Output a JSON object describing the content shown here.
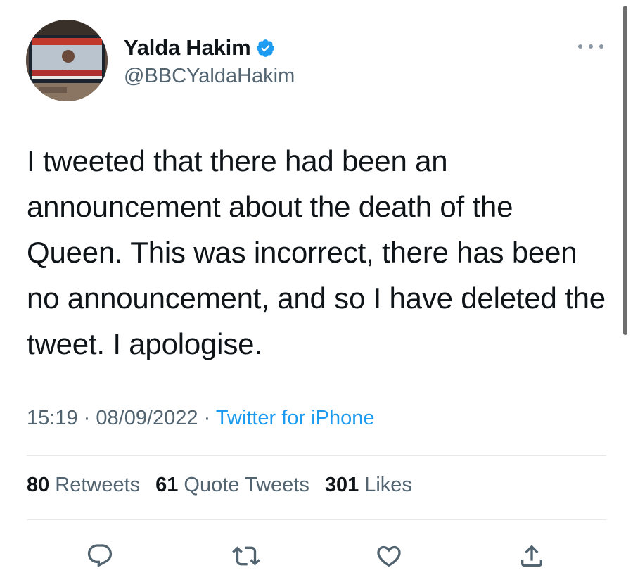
{
  "author": {
    "display_name": "Yalda Hakim",
    "handle": "@BBCYaldaHakim",
    "verified": true
  },
  "tweet": {
    "text": "I tweeted that there had been an announcement about the death of the Queen. This was incorrect, there has been no announcement, and so I have deleted the tweet. I apologise.",
    "time": "15:19",
    "date": "08/09/2022",
    "separator": "·",
    "source": "Twitter for iPhone"
  },
  "stats": [
    {
      "count": "80",
      "label": "Retweets"
    },
    {
      "count": "61",
      "label": "Quote Tweets"
    },
    {
      "count": "301",
      "label": "Likes"
    }
  ],
  "actions": {
    "reply_icon": "reply-icon",
    "retweet_icon": "retweet-icon",
    "like_icon": "heart-icon",
    "share_icon": "share-icon"
  },
  "colors": {
    "text": "#0f1419",
    "secondary": "#536471",
    "link": "#1d9bf0",
    "verified": "#1d9bf0"
  }
}
